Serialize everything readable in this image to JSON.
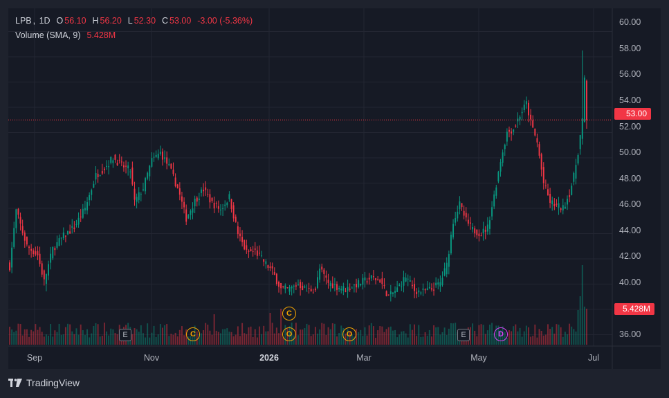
{
  "legend": {
    "symbol": "LPB",
    "interval": "1D",
    "o_label": "O",
    "o_value": "56.10",
    "h_label": "H",
    "h_value": "56.20",
    "l_label": "L",
    "l_value": "52.30",
    "c_label": "C",
    "c_value": "53.00",
    "change": "-3.00 (-5.36%)",
    "volume_label": "Volume (SMA, 9)",
    "volume_value": "5.428M"
  },
  "tags": {
    "last_price": "53.00",
    "last_volume": "5.428M"
  },
  "brand": {
    "name": "TradingView"
  },
  "events": [
    {
      "letter": "E",
      "kind": "earnings"
    },
    {
      "letter": "C",
      "kind": "conference"
    },
    {
      "letter": "C",
      "kind": "conference"
    },
    {
      "letter": "O",
      "kind": "other"
    },
    {
      "letter": "O",
      "kind": "other"
    },
    {
      "letter": "E",
      "kind": "earnings"
    },
    {
      "letter": "D",
      "kind": "dividend"
    }
  ],
  "colors": {
    "up": "#089981",
    "down": "#f23645",
    "event": "#f7a600",
    "dividend": "#e040fb",
    "background": "#161a25"
  },
  "chart_data": {
    "type": "candlestick",
    "symbol": "LPB",
    "interval": "1D",
    "y_ticks": [
      "60.00",
      "58.00",
      "56.00",
      "54.00",
      "52.00",
      "50.00",
      "48.00",
      "46.00",
      "44.00",
      "42.00",
      "40.00",
      "38.00",
      "36.00"
    ],
    "x_ticks": [
      "Sep",
      "Nov",
      "2026",
      "Mar",
      "May",
      "Jul"
    ],
    "ylim": [
      35.2,
      61.4
    ],
    "grid": true,
    "close_anchors": [
      {
        "t": 0,
        "c": 41.4
      },
      {
        "t": 3,
        "c": 45.8
      },
      {
        "t": 8,
        "c": 43.0
      },
      {
        "t": 13,
        "c": 42.3
      },
      {
        "t": 16,
        "c": 40.2
      },
      {
        "t": 20,
        "c": 42.8
      },
      {
        "t": 25,
        "c": 43.8
      },
      {
        "t": 30,
        "c": 44.5
      },
      {
        "t": 35,
        "c": 46.0
      },
      {
        "t": 40,
        "c": 48.6
      },
      {
        "t": 44,
        "c": 49.2
      },
      {
        "t": 48,
        "c": 50.0
      },
      {
        "t": 52,
        "c": 49.4
      },
      {
        "t": 56,
        "c": 49.0
      },
      {
        "t": 58,
        "c": 46.5
      },
      {
        "t": 62,
        "c": 47.6
      },
      {
        "t": 66,
        "c": 49.8
      },
      {
        "t": 70,
        "c": 50.4
      },
      {
        "t": 74,
        "c": 49.3
      },
      {
        "t": 78,
        "c": 47.6
      },
      {
        "t": 82,
        "c": 45.2
      },
      {
        "t": 86,
        "c": 46.6
      },
      {
        "t": 90,
        "c": 47.5
      },
      {
        "t": 94,
        "c": 46.4
      },
      {
        "t": 98,
        "c": 45.9
      },
      {
        "t": 102,
        "c": 46.9
      },
      {
        "t": 106,
        "c": 44.0
      },
      {
        "t": 110,
        "c": 42.5
      },
      {
        "t": 114,
        "c": 42.6
      },
      {
        "t": 118,
        "c": 41.8
      },
      {
        "t": 122,
        "c": 41.0
      },
      {
        "t": 126,
        "c": 39.6
      },
      {
        "t": 130,
        "c": 39.6
      },
      {
        "t": 134,
        "c": 40.0
      },
      {
        "t": 138,
        "c": 39.5
      },
      {
        "t": 142,
        "c": 39.6
      },
      {
        "t": 144,
        "c": 41.2
      },
      {
        "t": 148,
        "c": 40.1
      },
      {
        "t": 152,
        "c": 39.8
      },
      {
        "t": 156,
        "c": 39.6
      },
      {
        "t": 160,
        "c": 39.9
      },
      {
        "t": 164,
        "c": 40.2
      },
      {
        "t": 168,
        "c": 40.5
      },
      {
        "t": 172,
        "c": 40.3
      },
      {
        "t": 176,
        "c": 39.0
      },
      {
        "t": 180,
        "c": 39.6
      },
      {
        "t": 184,
        "c": 40.6
      },
      {
        "t": 188,
        "c": 39.5
      },
      {
        "t": 192,
        "c": 39.4
      },
      {
        "t": 196,
        "c": 39.6
      },
      {
        "t": 200,
        "c": 40.1
      },
      {
        "t": 203,
        "c": 41.5
      },
      {
        "t": 206,
        "c": 45.0
      },
      {
        "t": 209,
        "c": 46.3
      },
      {
        "t": 212,
        "c": 45.0
      },
      {
        "t": 215,
        "c": 44.3
      },
      {
        "t": 219,
        "c": 44.0
      },
      {
        "t": 222,
        "c": 44.5
      },
      {
        "t": 225,
        "c": 47.0
      },
      {
        "t": 228,
        "c": 49.8
      },
      {
        "t": 231,
        "c": 52.0
      },
      {
        "t": 234,
        "c": 52.3
      },
      {
        "t": 237,
        "c": 53.4
      },
      {
        "t": 240,
        "c": 54.3
      },
      {
        "t": 242,
        "c": 52.8
      },
      {
        "t": 245,
        "c": 51.2
      },
      {
        "t": 248,
        "c": 48.0
      },
      {
        "t": 251,
        "c": 46.5
      },
      {
        "t": 254,
        "c": 46.2
      },
      {
        "t": 257,
        "c": 46.0
      },
      {
        "t": 260,
        "c": 47.2
      },
      {
        "t": 262,
        "c": 48.5
      },
      {
        "t": 264,
        "c": 50.5
      },
      {
        "t": 266,
        "c": 53.0
      },
      {
        "t": 267,
        "c": 56.1
      },
      {
        "t": 268,
        "c": 53.0
      }
    ],
    "last_candle": {
      "o": 56.1,
      "h": 56.2,
      "l": 52.3,
      "c": 53.0
    },
    "volume_sma_9": 5.428,
    "volume_unit": "M"
  }
}
